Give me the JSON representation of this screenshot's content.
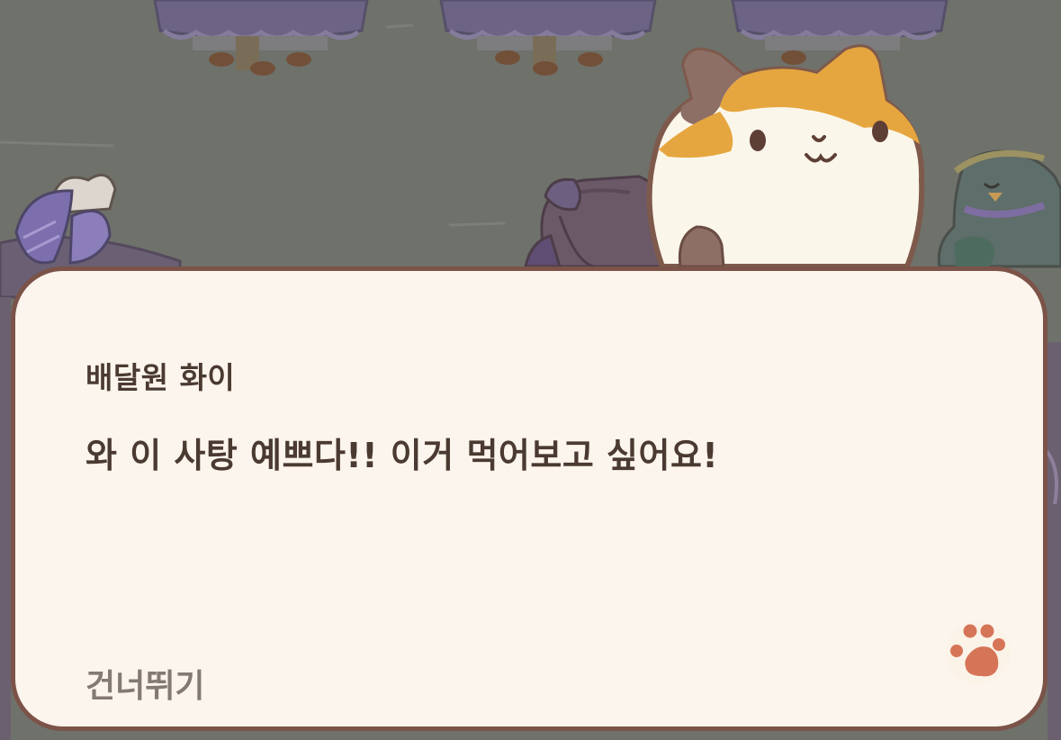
{
  "dialog": {
    "speaker": "배달원 화이",
    "message": "와 이 사탕 예쁘다!! 이거 먹어보고 싶어요!",
    "skip_label": "건너뛰기"
  },
  "icons": {
    "advance": "paw-icon"
  },
  "colors": {
    "background": "#6f716b",
    "dialog_fill": "#fcf5ed",
    "dialog_border": "#7b5348",
    "text": "#4a3a31",
    "skip_text": "#847a74",
    "paw": "#d67458"
  }
}
